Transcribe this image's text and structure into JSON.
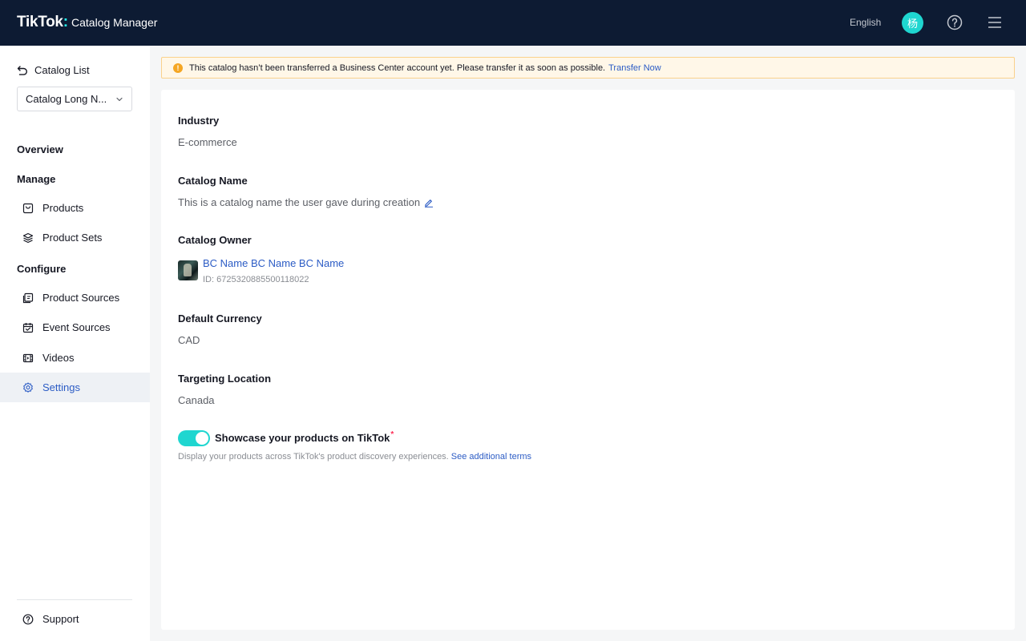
{
  "header": {
    "logo_brand": "TikTok",
    "logo_colon": ":",
    "logo_product": "Catalog Manager",
    "language": "English",
    "avatar_initial": "杨",
    "icons": [
      "help-icon",
      "menu-icon"
    ]
  },
  "sidebar": {
    "back_label": "Catalog List",
    "catalog_select_value": "Catalog Long N...",
    "overview": "Overview",
    "manage_heading": "Manage",
    "manage_items": [
      {
        "label": "Products",
        "icon": "products-icon"
      },
      {
        "label": "Product Sets",
        "icon": "layers-icon"
      }
    ],
    "configure_heading": "Configure",
    "configure_items": [
      {
        "label": "Product Sources",
        "icon": "product-sources-icon"
      },
      {
        "label": "Event Sources",
        "icon": "calendar-icon"
      },
      {
        "label": "Videos",
        "icon": "video-icon"
      },
      {
        "label": "Settings",
        "icon": "gear-icon",
        "active": true
      }
    ],
    "support_label": "Support"
  },
  "banner": {
    "message": "This catalog hasn’t been transferred a Business Center account yet. Please transfer it as soon as possible.",
    "link": "Transfer Now"
  },
  "settings": {
    "industry_label": "Industry",
    "industry_value": "E-commerce",
    "catalog_name_label": "Catalog Name",
    "catalog_name_value": "This is a catalog name the user gave during creation",
    "catalog_owner_label": "Catalog Owner",
    "owner_name": "BC Name BC Name BC Name",
    "owner_id": "ID: 6725320885500118022",
    "default_currency_label": "Default Currency",
    "default_currency_value": "CAD",
    "targeting_location_label": "Targeting Location",
    "targeting_location_value": "Canada",
    "showcase_label": "Showcase your products on TikTok",
    "showcase_required_mark": "*",
    "showcase_enabled": true,
    "showcase_desc": "Display your products across TikTok's product discovery experiences.",
    "showcase_link": "See additional terms"
  },
  "colors": {
    "header_bg": "#0d1b33",
    "accent_cyan": "#1fd6d0",
    "link_blue": "#2c5cc5",
    "warning_orange": "#f5a623"
  }
}
